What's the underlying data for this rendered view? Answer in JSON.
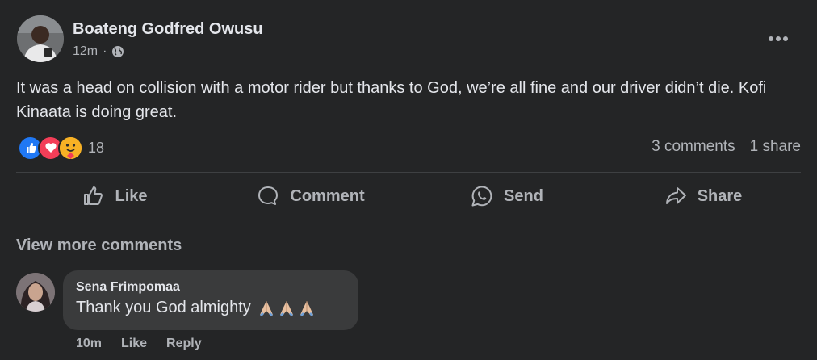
{
  "post": {
    "author": "Boateng Godfred Owusu",
    "time": "12m",
    "privacy_icon": "globe-icon",
    "text": "It was a head on collision with a motor rider but thanks to God, we’re all fine and our driver didn’t die. Kofi Kinaata is doing great.",
    "reactions": {
      "icons": [
        "like-icon",
        "love-icon",
        "care-icon"
      ],
      "count": "18"
    },
    "comments_count": "3 comments",
    "shares_count": "1 share"
  },
  "actions": {
    "like": "Like",
    "comment": "Comment",
    "send": "Send",
    "share": "Share"
  },
  "comments": {
    "view_more": "View more comments",
    "items": [
      {
        "author": "Sena Frimpomaa",
        "text": "Thank you God almighty",
        "emoji_icon": "praying-hands-icon",
        "time": "10m",
        "like_label": "Like",
        "reply_label": "Reply"
      }
    ]
  },
  "colors": {
    "background": "#242526",
    "bubble": "#3a3b3c",
    "primary_text": "#e4e6eb",
    "secondary_text": "#b0b3b8",
    "like_blue": "#2078f4",
    "love_red": "#f33e58",
    "care_yellow": "#f7b125"
  }
}
